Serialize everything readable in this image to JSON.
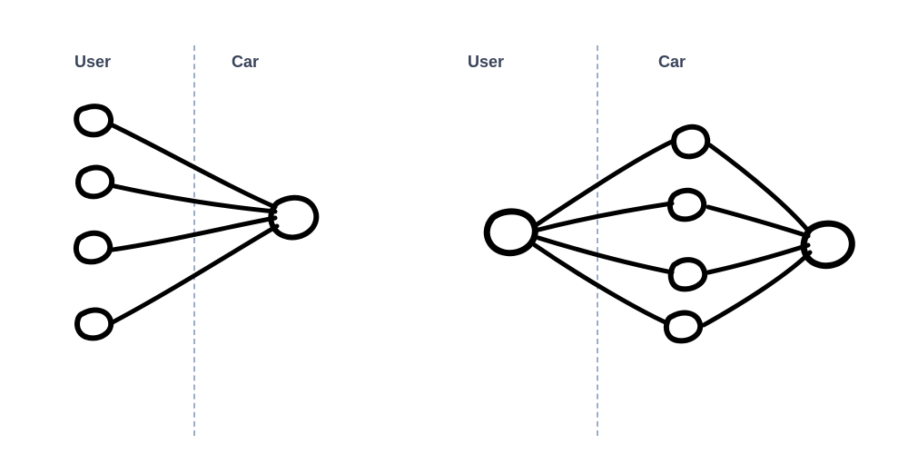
{
  "diagrams": {
    "left": {
      "labels": {
        "left": "User",
        "right": "Car"
      },
      "description": "Many-to-one: four User nodes on the left each connect to a single Car node on the right across a dashed boundary.",
      "nodes": {
        "left_count": 4,
        "right_count": 1
      }
    },
    "right": {
      "labels": {
        "left": "User",
        "right": "Car"
      },
      "description": "One-to-many-to-one: a single User node on the left connects to four intermediate nodes which all connect to a single Car node on the right, with a dashed boundary between User and the intermediates.",
      "nodes": {
        "left_count": 1,
        "middle_count": 4,
        "right_count": 1
      }
    }
  }
}
